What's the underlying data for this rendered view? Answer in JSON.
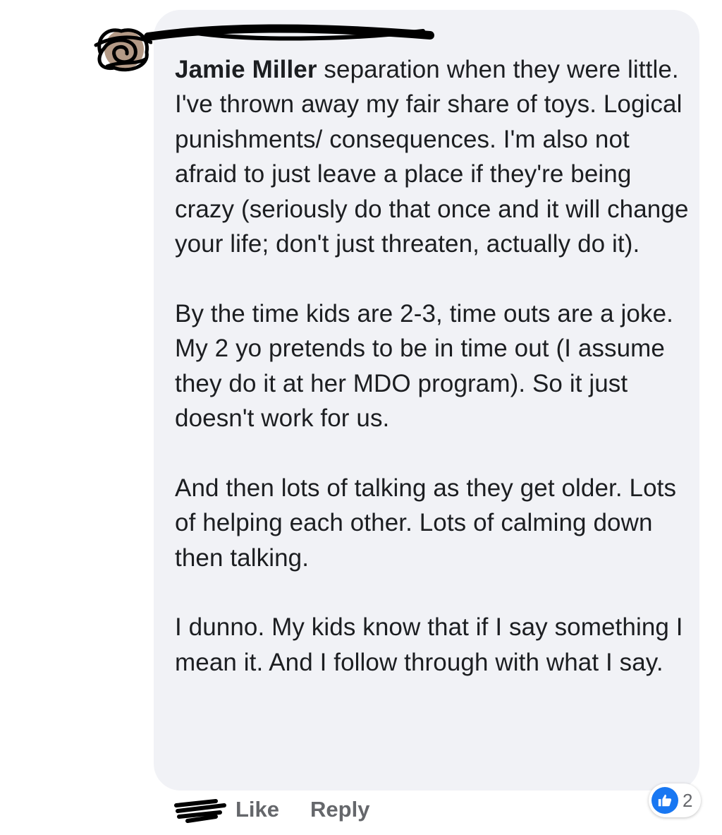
{
  "comment": {
    "author": "Jamie Miller",
    "paragraphs": [
      "separation when they were little. I've thrown away my fair share of toys. Logical punishments/ consequences. I'm also not afraid to just leave a place if they're being crazy (seriously do that once and it will change your life; don't just threaten, actually do it).",
      "By the time kids are 2-3, time outs are a joke. My 2 yo pretends to be in time out (I assume they do it at her MDO program). So it just doesn't work for us.",
      "And then lots of talking as they get older. Lots of helping each other. Lots of calming down then talking.",
      "I dunno. My kids know that if I say something I mean it. And I follow through with what I say."
    ]
  },
  "actions": {
    "like_label": "Like",
    "reply_label": "Reply"
  },
  "reactions": {
    "icon": "thumbs-up-icon",
    "count": "2"
  },
  "colors": {
    "bubble_bg": "#f1f2f6",
    "text": "#1c1e21",
    "muted": "#65676b",
    "like_blue": "#1877f2"
  }
}
